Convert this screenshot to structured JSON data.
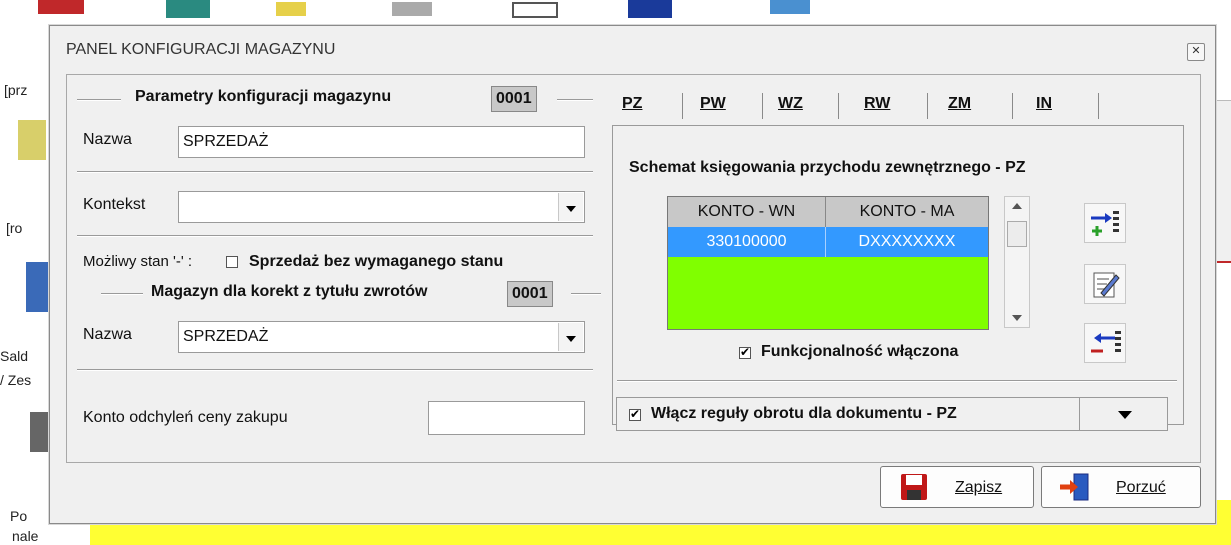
{
  "background": {
    "left_texts": [
      "[prz",
      "[ro",
      "Sald",
      "/ Zes",
      "Po",
      "nale"
    ],
    "accent_yellow": "#ffff33"
  },
  "dialog": {
    "title": "PANEL KONFIGURACJI MAGAZYNU",
    "close_icon": "close-icon"
  },
  "left": {
    "params_header": "Parametry konfiguracji  magazynu",
    "params_code": "0001",
    "name_label": "Nazwa",
    "name_value": "SPRZEDAŻ",
    "context_label": "Kontekst",
    "context_value": "",
    "negative_stock_label": "Możliwy stan '-' :",
    "negative_stock_checked": false,
    "sale_without_stock_label": "Sprzedaż bez wymaganego stanu",
    "corrections_header": "Magazyn dla korekt z tytułu zwrotów",
    "corrections_code": "0001",
    "corr_name_label": "Nazwa",
    "corr_name_value": "SPRZEDAŻ",
    "price_dev_label": "Konto odchyleń  ceny  zakupu",
    "price_dev_value": ""
  },
  "tabs": [
    {
      "label": "PZ",
      "active": true
    },
    {
      "label": "PW"
    },
    {
      "label": "WZ"
    },
    {
      "label": "RW"
    },
    {
      "label": "ZM"
    },
    {
      "label": "IN"
    }
  ],
  "pz": {
    "scheme_title": "Schemat księgowania przychodu zewnętrznego - PZ",
    "columns": [
      "KONTO - WN",
      "KONTO - MA"
    ],
    "rows": [
      [
        "330100000",
        "DXXXXXXXX"
      ]
    ],
    "grid_bg": "#80ff00",
    "selected_bg": "#3399ff",
    "functionality_label": "Funkcjonalność włączona",
    "functionality_checked": true,
    "rules_label": "Włącz reguły obrotu dla dokumentu - PZ",
    "rules_checked": true,
    "toolbar": [
      "add-row-icon",
      "edit-icon",
      "remove-row-icon"
    ]
  },
  "buttons": {
    "save": "Zapisz",
    "cancel": "Porzuć"
  }
}
